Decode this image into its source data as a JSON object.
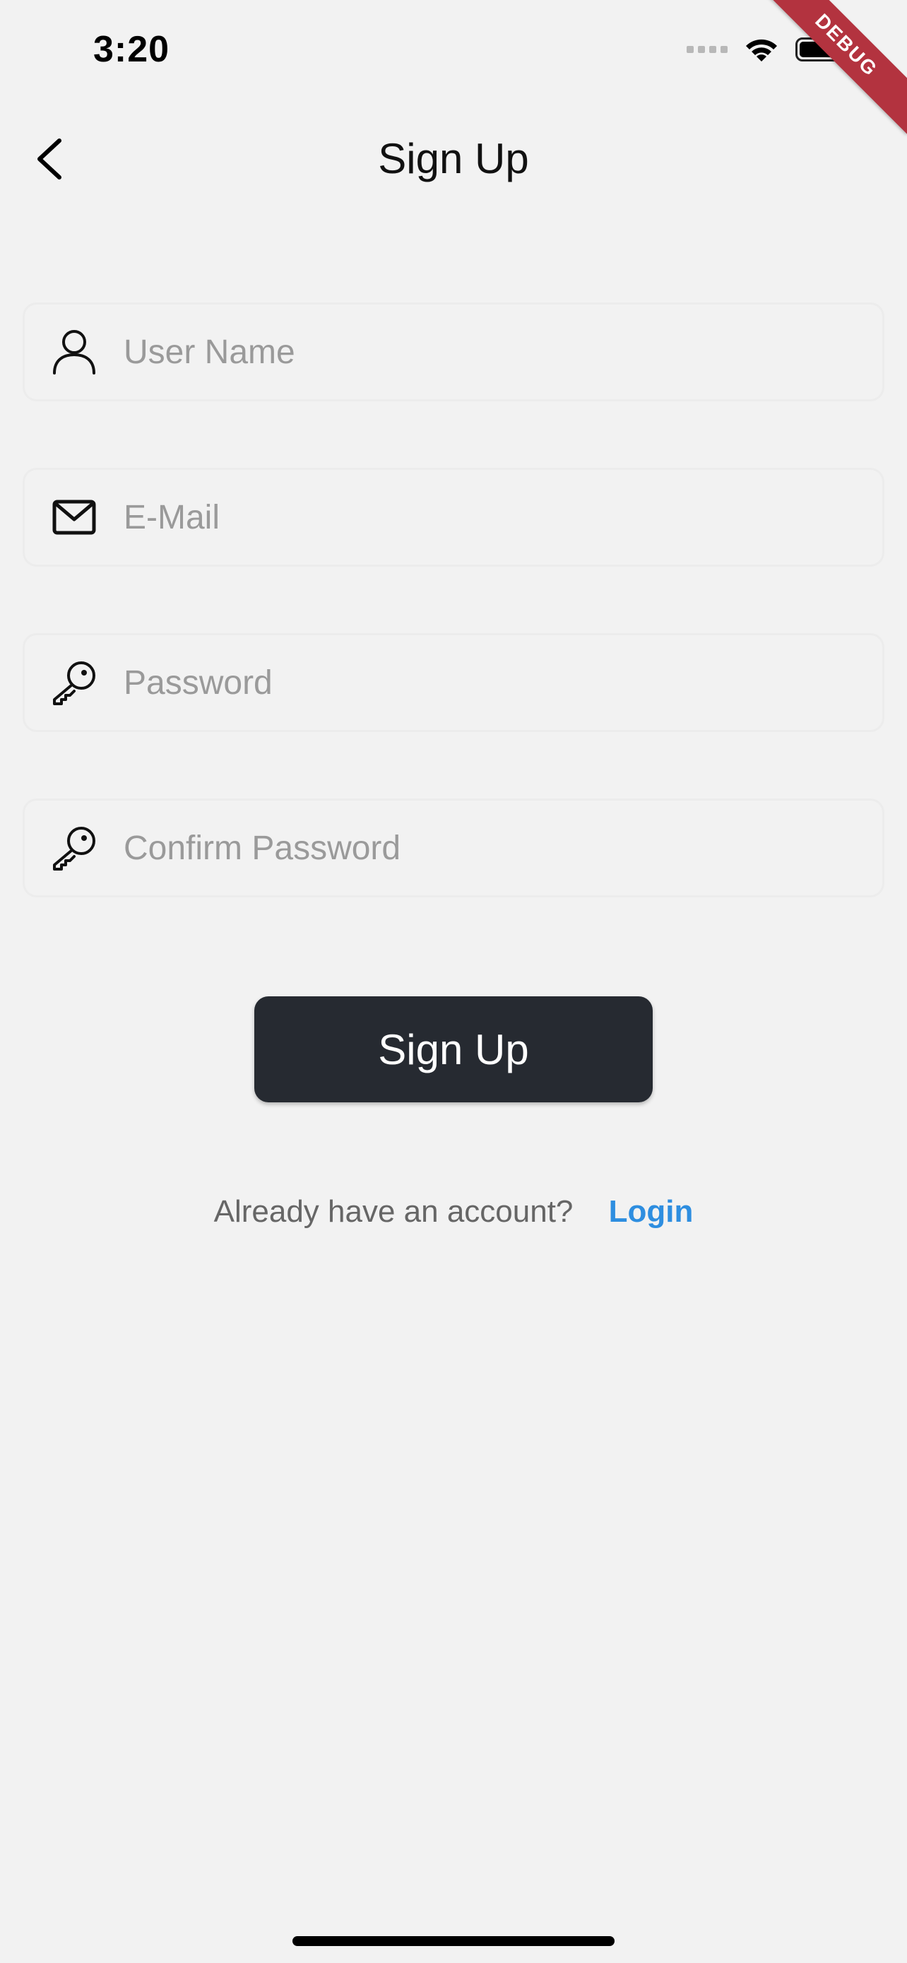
{
  "status_bar": {
    "time": "3:20"
  },
  "debug_banner": {
    "label": "DEBUG"
  },
  "app_bar": {
    "title": "Sign Up"
  },
  "form": {
    "fields": [
      {
        "placeholder": "User Name",
        "value": "",
        "icon": "user-icon"
      },
      {
        "placeholder": "E-Mail",
        "value": "",
        "icon": "mail-icon"
      },
      {
        "placeholder": "Password",
        "value": "",
        "icon": "key-icon"
      },
      {
        "placeholder": "Confirm Password",
        "value": "",
        "icon": "key-icon"
      }
    ],
    "submit_label": "Sign Up"
  },
  "footer": {
    "prompt": "Already have an account?",
    "login_label": "Login"
  },
  "colors": {
    "background": "#f2f2f2",
    "button": "#262a31",
    "link": "#2e8ee0",
    "debug_banner": "#b3333f"
  }
}
